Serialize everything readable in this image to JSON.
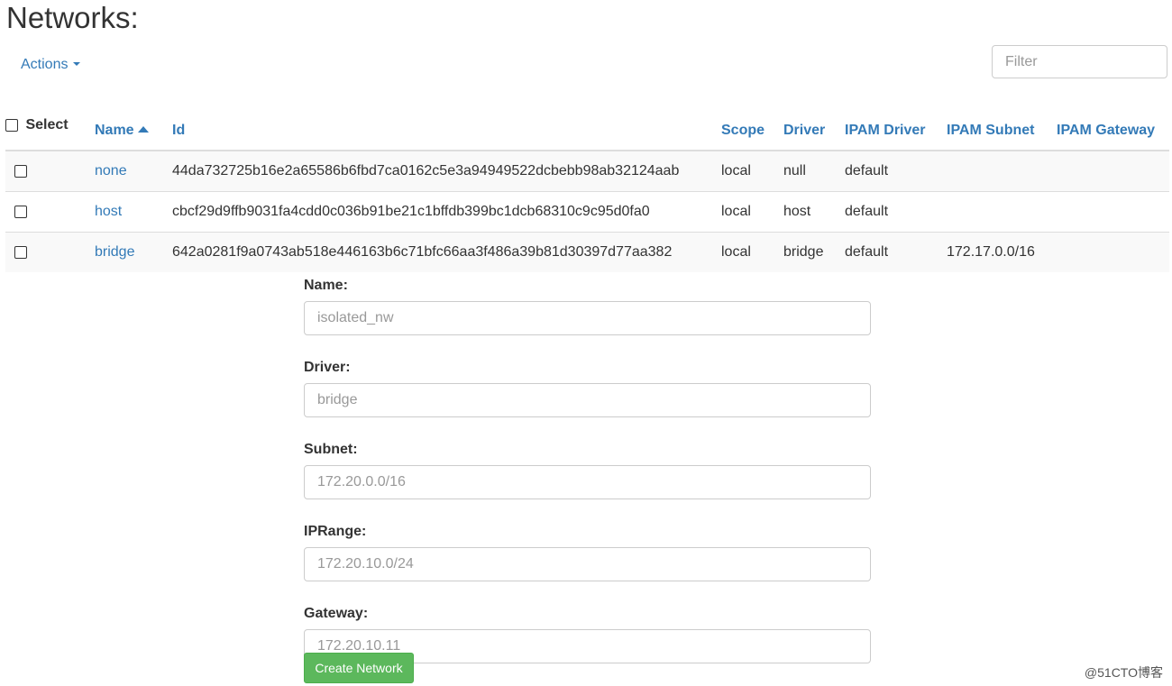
{
  "page": {
    "title": "Networks:"
  },
  "toolbar": {
    "actions_label": "Actions",
    "filter_placeholder": "Filter"
  },
  "table": {
    "headers": {
      "select": "Select",
      "name": "Name",
      "id": "Id",
      "scope": "Scope",
      "driver": "Driver",
      "ipam_driver": "IPAM Driver",
      "ipam_subnet": "IPAM Subnet",
      "ipam_gateway": "IPAM Gateway"
    },
    "sort": {
      "column": "Name",
      "direction": "ascending"
    },
    "rows": [
      {
        "name": "none",
        "id": "44da732725b16e2a65586b6fbd7ca0162c5e3a94949522dcbebb98ab32124aab",
        "scope": "local",
        "driver": "null",
        "ipam_driver": "default",
        "ipam_subnet": "",
        "ipam_gateway": ""
      },
      {
        "name": "host",
        "id": "cbcf29d9ffb9031fa4cdd0c036b91be21c1bffdb399bc1dcb68310c9c95d0fa0",
        "scope": "local",
        "driver": "host",
        "ipam_driver": "default",
        "ipam_subnet": "",
        "ipam_gateway": ""
      },
      {
        "name": "bridge",
        "id": "642a0281f9a0743ab518e446163b6c71bfc66aa3f486a39b81d30397d77aa382",
        "scope": "local",
        "driver": "bridge",
        "ipam_driver": "default",
        "ipam_subnet": "172.17.0.0/16",
        "ipam_gateway": ""
      }
    ]
  },
  "form": {
    "name": {
      "label": "Name:",
      "placeholder": "isolated_nw",
      "value": ""
    },
    "driver": {
      "label": "Driver:",
      "placeholder": "bridge",
      "value": ""
    },
    "subnet": {
      "label": "Subnet:",
      "placeholder": "172.20.0.0/16",
      "value": ""
    },
    "iprange": {
      "label": "IPRange:",
      "placeholder": "172.20.10.0/24",
      "value": ""
    },
    "gateway": {
      "label": "Gateway:",
      "placeholder": "172.20.10.11",
      "value": ""
    },
    "submit_label": "Create Network"
  },
  "watermark": "@51CTO博客",
  "colors": {
    "link": "#337ab7",
    "button": "#5cb85c",
    "stripe": "#f9f9f9"
  },
  "icons": {
    "sort": "chevron-up-icon",
    "actions_caret": "caret-down-icon"
  }
}
